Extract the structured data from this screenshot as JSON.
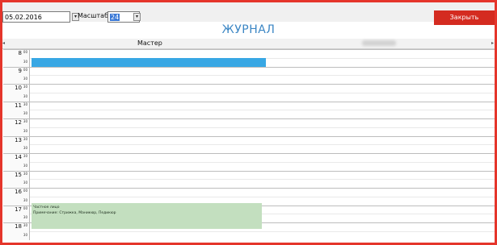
{
  "toolbar": {
    "date_value": "05.02.2016",
    "scale_label": "Масштаб:",
    "scale_value": "24",
    "close_label": "Закрыть"
  },
  "title": "ЖУРНАЛ",
  "column_header": {
    "master_label": "Мастер"
  },
  "time_rows": [
    {
      "hour": "8",
      "min_top": "00",
      "min_bottom": "30"
    },
    {
      "hour": "9",
      "min_top": "00",
      "min_bottom": "30"
    },
    {
      "hour": "10",
      "min_top": "30",
      "min_bottom": "30"
    },
    {
      "hour": "11",
      "min_top": "30",
      "min_bottom": "30"
    },
    {
      "hour": "12",
      "min_top": "30",
      "min_bottom": "30"
    },
    {
      "hour": "13",
      "min_top": "30",
      "min_bottom": "30"
    },
    {
      "hour": "14",
      "min_top": "30",
      "min_bottom": "30"
    },
    {
      "hour": "15",
      "min_top": "30",
      "min_bottom": "30"
    },
    {
      "hour": "16",
      "min_top": "00",
      "min_bottom": "30"
    },
    {
      "hour": "17",
      "min_top": "00",
      "min_bottom": "30"
    },
    {
      "hour": "18",
      "min_top": "30",
      "min_bottom": "30"
    }
  ],
  "appointment_green": {
    "line1": "Частное лицо",
    "line2": "Примечание: Стрижка, Маникюр, Педикюр"
  },
  "colors": {
    "frame": "#e5352b",
    "close": "#d42b20",
    "title": "#3b86c4",
    "blue_block": "#38a7e4",
    "green_block": "#c3dfbf"
  }
}
